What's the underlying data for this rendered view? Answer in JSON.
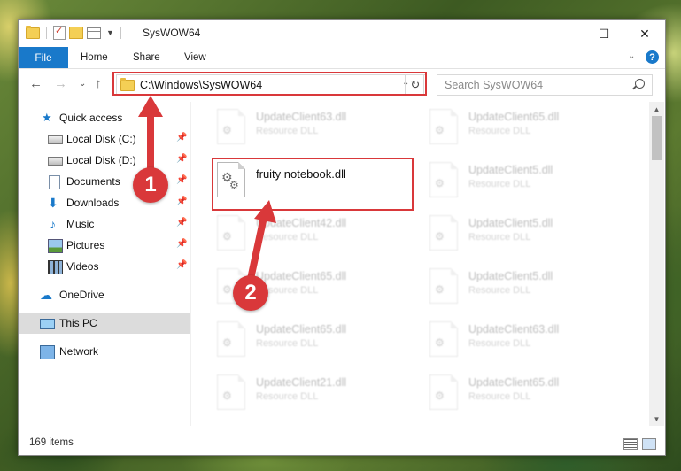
{
  "window": {
    "title": "SysWOW64",
    "controls": {
      "minimize": "—",
      "maximize": "☐",
      "close": "✕"
    }
  },
  "ribbon": {
    "tabs": [
      {
        "label": "File"
      },
      {
        "label": "Home"
      },
      {
        "label": "Share"
      },
      {
        "label": "View"
      }
    ],
    "help": "?"
  },
  "navigation": {
    "address": "C:\\Windows\\SysWOW64",
    "search_placeholder": "Search SysWOW64"
  },
  "sidebar": {
    "items": [
      {
        "label": "Quick access",
        "icon": "star-icon"
      },
      {
        "label": "Local Disk (C:)",
        "icon": "drive-icon",
        "pinned": true
      },
      {
        "label": "Local Disk (D:)",
        "icon": "drive-icon",
        "pinned": true
      },
      {
        "label": "Documents",
        "icon": "document-icon",
        "pinned": true
      },
      {
        "label": "Downloads",
        "icon": "download-icon",
        "pinned": true
      },
      {
        "label": "Music",
        "icon": "music-icon",
        "pinned": true
      },
      {
        "label": "Pictures",
        "icon": "picture-icon",
        "pinned": true
      },
      {
        "label": "Videos",
        "icon": "video-icon",
        "pinned": true
      },
      {
        "label": "OneDrive",
        "icon": "cloud-icon"
      },
      {
        "label": "This PC",
        "icon": "computer-icon",
        "selected": true
      },
      {
        "label": "Network",
        "icon": "network-icon"
      }
    ]
  },
  "files": {
    "left": [
      {
        "name": "UpdateClient63.dll",
        "type": "Resource DLL"
      },
      {
        "name": "fruity notebook.dll",
        "type": ""
      },
      {
        "name": "UpdateClient42.dll",
        "type": "Resource DLL"
      },
      {
        "name": "UpdateClient65.dll",
        "type": "Resource DLL"
      },
      {
        "name": "UpdateClient65.dll",
        "type": "Resource DLL"
      },
      {
        "name": "UpdateClient21.dll",
        "type": "Resource DLL"
      }
    ],
    "right": [
      {
        "name": "UpdateClient65.dll",
        "type": "Resource DLL"
      },
      {
        "name": "UpdateClient5.dll",
        "type": "Resource DLL"
      },
      {
        "name": "UpdateClient5.dll",
        "type": "Resource DLL"
      },
      {
        "name": "UpdateClient5.dll",
        "type": "Resource DLL"
      },
      {
        "name": "UpdateClient63.dll",
        "type": "Resource DLL"
      },
      {
        "name": "UpdateClient65.dll",
        "type": "Resource DLL"
      }
    ]
  },
  "status": {
    "item_count": "169 items"
  },
  "annotations": {
    "step1": "1",
    "step2": "2",
    "color": "#d9383a"
  }
}
